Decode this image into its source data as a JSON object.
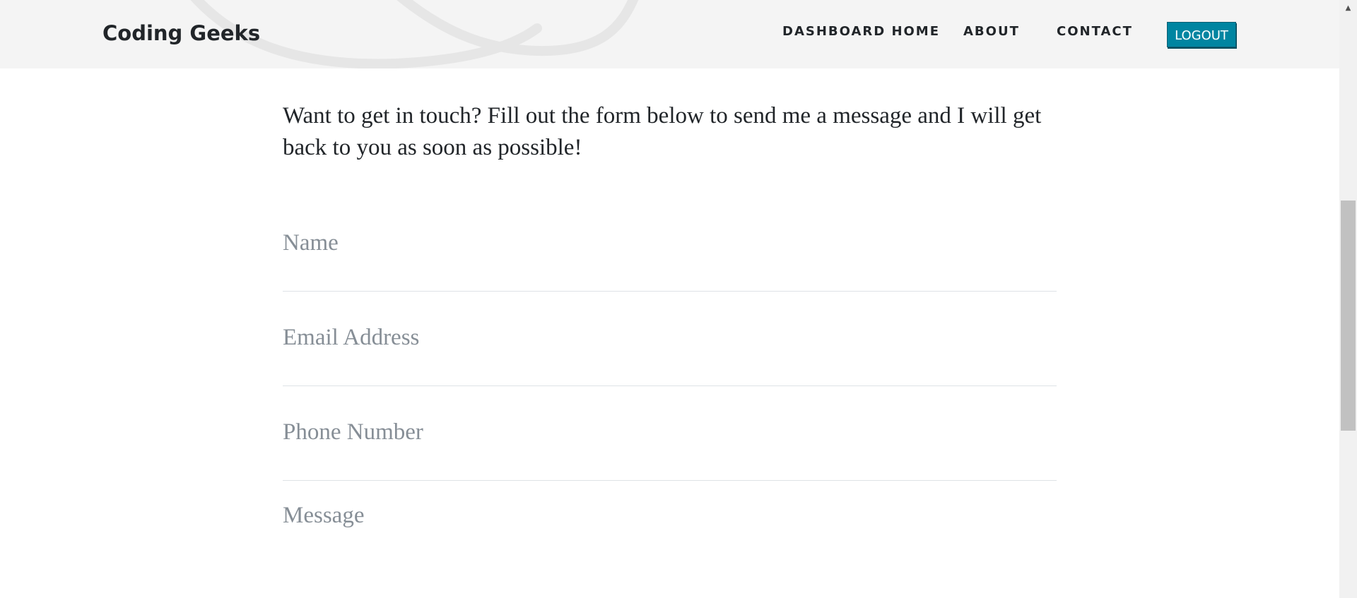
{
  "navbar": {
    "brand": "Coding Geeks",
    "links": [
      {
        "label": "DASHBOARD HOME"
      },
      {
        "label": "ABOUT"
      },
      {
        "label": "CONTACT"
      }
    ],
    "logout_label": "LOGOUT"
  },
  "main": {
    "intro": "Want to get in touch? Fill out the form below to send me a message and I will get back to you as soon as possible!",
    "form": {
      "name_placeholder": "Name",
      "email_placeholder": "Email Address",
      "phone_placeholder": "Phone Number",
      "message_placeholder": "Message"
    }
  },
  "scrollbar": {
    "up_arrow": "▲"
  },
  "colors": {
    "accent": "#0085a1",
    "navbar_bg": "#f4f4f4",
    "placeholder": "#868e96"
  }
}
